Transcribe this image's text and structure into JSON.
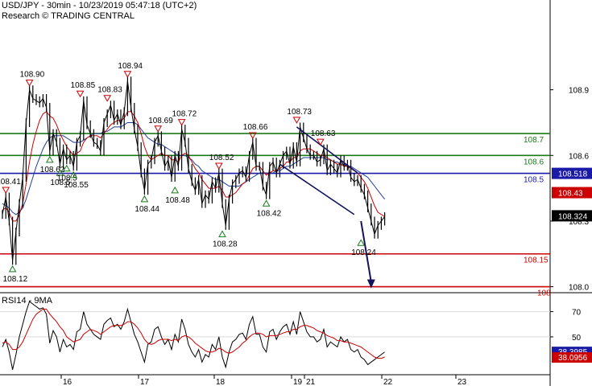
{
  "header": {
    "title": "USD/JPY - 30min - 10/23/2019 05:47:18 (UTC+2)",
    "source": "Research © TRADING CENTRAL"
  },
  "rsi_panel_label": "RSI14 - 9MA",
  "colors": {
    "price": "#000000",
    "ma_red": "#cc0000",
    "ma_blue": "#1f3d99",
    "resistance": "#1a7a1a",
    "pivot": "#1a1aa6",
    "support": "#cc0000",
    "peak_marker": "#cc0000",
    "trough_marker": "#1a7a1a",
    "channel": "#14145e"
  },
  "chart_data": [
    {
      "type": "line",
      "name": "price",
      "y_ticks": [
        "108.9",
        "108.6",
        "108.3",
        "108.0"
      ],
      "ylim": [
        107.98,
        109.2
      ],
      "x_ticks": [
        "16",
        "17",
        "18",
        "19",
        "21",
        "22",
        "23"
      ],
      "x": [
        0,
        2,
        4,
        6,
        8,
        10,
        12,
        14,
        16,
        18,
        20,
        22,
        24,
        26,
        28,
        30,
        32,
        34,
        36,
        38,
        40,
        42,
        44,
        46,
        48,
        50,
        52,
        54,
        56,
        58,
        60,
        62,
        64,
        66,
        68,
        70,
        72,
        74,
        76,
        78,
        80,
        82,
        84,
        86,
        88,
        90,
        92,
        94,
        96,
        98,
        100,
        102,
        104,
        106,
        108,
        110,
        112,
        114,
        116,
        118,
        120,
        122,
        124,
        126,
        128,
        130,
        132,
        134,
        136,
        138,
        140,
        142,
        144,
        146,
        148,
        150,
        152,
        154,
        156,
        158,
        160,
        162,
        164,
        166,
        168,
        170,
        172,
        174,
        176,
        178,
        180,
        182,
        184,
        186,
        188,
        190,
        192,
        194,
        196,
        198,
        200,
        202,
        204,
        206,
        208,
        210,
        212,
        214,
        216,
        218,
        220,
        222,
        224,
        226,
        228,
        230,
        232,
        234,
        236,
        238,
        240,
        242,
        244,
        246,
        248,
        250,
        252,
        254,
        256,
        258,
        260,
        262,
        264,
        266,
        268,
        270,
        272,
        274,
        276
      ],
      "values": [
        108.33,
        108.41,
        108.3,
        108.12,
        108.25,
        108.38,
        108.5,
        108.75,
        108.9,
        108.86,
        108.85,
        108.84,
        108.86,
        108.82,
        108.62,
        108.7,
        108.66,
        108.56,
        108.63,
        108.58,
        108.6,
        108.55,
        108.66,
        108.69,
        108.85,
        108.74,
        108.7,
        108.66,
        108.65,
        108.62,
        108.75,
        108.79,
        108.83,
        108.76,
        108.79,
        108.74,
        108.8,
        108.94,
        108.82,
        108.72,
        108.64,
        108.52,
        108.44,
        108.56,
        108.58,
        108.66,
        108.69,
        108.62,
        108.55,
        108.58,
        108.5,
        108.6,
        108.55,
        108.72,
        108.66,
        108.54,
        108.48,
        108.44,
        108.49,
        108.38,
        108.42,
        108.4,
        108.48,
        108.45,
        108.52,
        108.38,
        108.28,
        108.4,
        108.47,
        108.49,
        108.52,
        108.53,
        108.5,
        108.6,
        108.66,
        108.55,
        108.55,
        108.46,
        108.42,
        108.55,
        108.57,
        108.52,
        108.56,
        108.6,
        108.62,
        108.56,
        108.64,
        108.57,
        108.73,
        108.68,
        108.63,
        108.6,
        108.6,
        108.57,
        108.58,
        108.63,
        108.53,
        108.56,
        108.54,
        108.52,
        108.58,
        108.55,
        108.56,
        108.5,
        108.48,
        108.49,
        108.45,
        108.42,
        108.36,
        108.3,
        108.24,
        108.28,
        108.3,
        108.32
      ],
      "ma_red": [
        108.35,
        108.36,
        108.34,
        108.3,
        108.3,
        108.33,
        108.38,
        108.47,
        108.57,
        108.65,
        108.71,
        108.76,
        108.79,
        108.8,
        108.78,
        108.77,
        108.74,
        108.7,
        108.67,
        108.64,
        108.62,
        108.6,
        108.61,
        108.62,
        108.66,
        108.68,
        108.69,
        108.69,
        108.69,
        108.68,
        108.7,
        108.72,
        108.74,
        108.75,
        108.76,
        108.76,
        108.77,
        108.8,
        108.8,
        108.78,
        108.75,
        108.7,
        108.64,
        108.6,
        108.58,
        108.59,
        108.6,
        108.61,
        108.6,
        108.6,
        108.58,
        108.58,
        108.57,
        108.6,
        108.61,
        108.6,
        108.57,
        108.54,
        108.52,
        108.49,
        108.47,
        108.45,
        108.45,
        108.45,
        108.46,
        108.44,
        108.41,
        108.41,
        108.42,
        108.43,
        108.45,
        108.47,
        108.48,
        108.51,
        108.54,
        108.55,
        108.55,
        108.53,
        108.51,
        108.52,
        108.53,
        108.53,
        108.54,
        108.55,
        108.57,
        108.57,
        108.59,
        108.59,
        108.62,
        108.63,
        108.63,
        108.63,
        108.62,
        108.61,
        108.6,
        108.6,
        108.59,
        108.58,
        108.57,
        108.56,
        108.56,
        108.55,
        108.55,
        108.54,
        108.53,
        108.52,
        108.5,
        108.48,
        108.45,
        108.41,
        108.37,
        108.34,
        108.33,
        108.32
      ],
      "ma_blue": [
        108.38,
        108.37,
        108.36,
        108.34,
        108.33,
        108.34,
        108.36,
        108.4,
        108.45,
        108.5,
        108.55,
        108.59,
        108.63,
        108.66,
        108.68,
        108.69,
        108.69,
        108.69,
        108.69,
        108.68,
        108.67,
        108.66,
        108.66,
        108.66,
        108.67,
        108.68,
        108.69,
        108.7,
        108.7,
        108.7,
        108.71,
        108.71,
        108.72,
        108.73,
        108.73,
        108.73,
        108.74,
        108.75,
        108.75,
        108.75,
        108.74,
        108.72,
        108.7,
        108.68,
        108.67,
        108.66,
        108.65,
        108.65,
        108.64,
        108.63,
        108.62,
        108.61,
        108.6,
        108.6,
        108.6,
        108.59,
        108.58,
        108.56,
        108.55,
        108.53,
        108.52,
        108.51,
        108.5,
        108.49,
        108.49,
        108.48,
        108.47,
        108.46,
        108.46,
        108.46,
        108.46,
        108.47,
        108.48,
        108.49,
        108.5,
        108.51,
        108.52,
        108.52,
        108.52,
        108.52,
        108.52,
        108.53,
        108.53,
        108.54,
        108.55,
        108.55,
        108.56,
        108.57,
        108.58,
        108.59,
        108.59,
        108.59,
        108.59,
        108.59,
        108.59,
        108.59,
        108.58,
        108.58,
        108.57,
        108.57,
        108.56,
        108.56,
        108.55,
        108.55,
        108.54,
        108.53,
        108.52,
        108.51,
        108.5,
        108.48,
        108.46,
        108.44,
        108.42,
        108.4
      ],
      "levels": [
        {
          "name": "resistance-108-7",
          "value": 108.7,
          "label": "108.7",
          "color": "#1a7a1a"
        },
        {
          "name": "resistance-108-6",
          "value": 108.6,
          "label": "108.6",
          "color": "#1a7a1a"
        },
        {
          "name": "pivot-108-5",
          "value": 108.518,
          "label": "108.5",
          "color": "#1a1aa6"
        },
        {
          "name": "support-108-15",
          "value": 108.15,
          "label": "108.15",
          "color": "#cc0000"
        },
        {
          "name": "support-108",
          "value": 108.0,
          "label": "108",
          "color": "#cc0000"
        }
      ],
      "price_tags": [
        {
          "name": "pivot-value-tag",
          "value": 108.518,
          "label": "108.518",
          "bg": "#1a1aa6",
          "fg": "#ffffff"
        },
        {
          "name": "ma-value-tag",
          "value": 108.43,
          "label": "108.43",
          "bg": "#cc0000",
          "fg": "#ffffff"
        },
        {
          "name": "last-price-tag",
          "value": 108.324,
          "label": "108.324",
          "bg": "#000000",
          "fg": "#ffffff"
        }
      ],
      "peaks": [
        {
          "x": 16,
          "value": 108.9,
          "label": "108.90"
        },
        {
          "x": 46,
          "value": 108.85,
          "label": "108.85"
        },
        {
          "x": 62,
          "value": 108.83,
          "label": "108.83"
        },
        {
          "x": 74,
          "value": 108.94,
          "label": "108.94"
        },
        {
          "x": 92,
          "value": 108.69,
          "label": "108.69"
        },
        {
          "x": 106,
          "value": 108.72,
          "label": "108.72"
        },
        {
          "x": 128,
          "value": 108.52,
          "label": "108.52"
        },
        {
          "x": 148,
          "value": 108.66,
          "label": "108.66"
        },
        {
          "x": 174,
          "value": 108.73,
          "label": "108.73"
        },
        {
          "x": 188,
          "value": 108.63,
          "label": "108.63"
        },
        {
          "x": 2,
          "value": 108.41,
          "label": "108.41"
        }
      ],
      "troughs": [
        {
          "x": 6,
          "value": 108.12,
          "label": "108.12"
        },
        {
          "x": 28,
          "value": 108.62,
          "label": "108.62"
        },
        {
          "x": 34,
          "value": 108.56,
          "label": "108.5"
        },
        {
          "x": 38,
          "value": 108.58,
          "label": "108.5"
        },
        {
          "x": 42,
          "value": 108.55,
          "label": "108.55"
        },
        {
          "x": 84,
          "value": 108.44,
          "label": "108.44"
        },
        {
          "x": 102,
          "value": 108.48,
          "label": "108.48"
        },
        {
          "x": 130,
          "value": 108.28,
          "label": "108.28"
        },
        {
          "x": 156,
          "value": 108.42,
          "label": "108.42"
        },
        {
          "x": 212,
          "value": 108.24,
          "label": "108.24"
        }
      ],
      "channel": {
        "upper": [
          [
            174,
            108.73
          ],
          [
            210,
            108.52
          ]
        ],
        "lower": [
          [
            164,
            108.56
          ],
          [
            208,
            108.33
          ]
        ]
      },
      "projection": [
        [
          212,
          108.3
        ],
        [
          218,
          108.0
        ]
      ]
    },
    {
      "type": "line",
      "name": "RSI14 - 9MA",
      "y_ticks": [
        "70",
        "50"
      ],
      "ylim": [
        20,
        85
      ],
      "rsi": [
        42,
        48,
        38,
        24,
        36,
        50,
        60,
        70,
        78,
        76,
        74,
        72,
        73,
        68,
        45,
        55,
        50,
        38,
        48,
        42,
        44,
        40,
        54,
        56,
        70,
        60,
        56,
        52,
        50,
        48,
        60,
        63,
        65,
        58,
        60,
        56,
        62,
        72,
        62,
        52,
        46,
        38,
        30,
        44,
        46,
        56,
        58,
        50,
        44,
        48,
        40,
        52,
        46,
        64,
        56,
        44,
        38,
        34,
        40,
        30,
        36,
        34,
        44,
        40,
        50,
        34,
        26,
        38,
        46,
        48,
        52,
        53,
        48,
        60,
        66,
        52,
        52,
        42,
        38,
        54,
        56,
        48,
        54,
        58,
        60,
        52,
        62,
        52,
        70,
        62,
        54,
        50,
        50,
        46,
        48,
        56,
        42,
        46,
        44,
        42,
        50,
        46,
        48,
        40,
        38,
        40,
        34,
        32,
        28,
        30,
        32,
        34,
        36,
        38
      ],
      "rsi_ma": [
        45,
        46,
        44,
        40,
        40,
        42,
        46,
        52,
        58,
        64,
        68,
        70,
        72,
        72,
        68,
        65,
        62,
        58,
        55,
        50,
        48,
        46,
        47,
        48,
        52,
        54,
        56,
        55,
        54,
        52,
        54,
        56,
        58,
        59,
        59,
        59,
        60,
        62,
        62,
        60,
        57,
        53,
        48,
        45,
        44,
        45,
        47,
        48,
        48,
        48,
        47,
        48,
        47,
        50,
        51,
        50,
        48,
        45,
        43,
        41,
        39,
        38,
        38,
        39,
        41,
        40,
        38,
        37,
        38,
        40,
        42,
        45,
        47,
        50,
        52,
        53,
        53,
        52,
        50,
        51,
        51,
        51,
        52,
        53,
        54,
        54,
        56,
        56,
        58,
        59,
        59,
        58,
        57,
        55,
        54,
        53,
        51,
        50,
        49,
        47,
        47,
        46,
        46,
        45,
        44,
        43,
        42,
        40,
        38,
        36,
        34,
        33,
        33,
        34
      ]
    }
  ]
}
